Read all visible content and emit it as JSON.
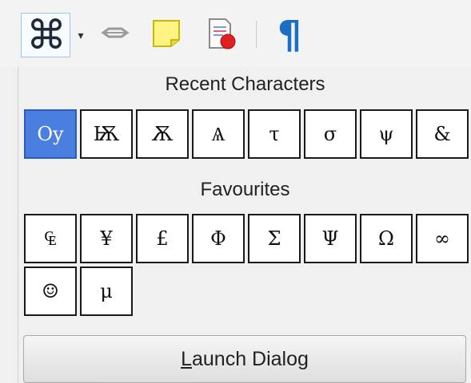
{
  "toolbar": {
    "items": [
      {
        "name": "special-character-button",
        "glyph": "⌘"
      },
      {
        "name": "dropdown-arrow",
        "glyph": "▾"
      },
      {
        "name": "hyperlink-icon"
      },
      {
        "name": "comment-icon"
      },
      {
        "name": "track-changes-icon"
      },
      {
        "name": "formatting-marks-icon",
        "glyph": "¶"
      }
    ]
  },
  "recent": {
    "title": "Recent Characters",
    "chars": [
      "Oy",
      "Ѭ",
      "Ѫ",
      "Ѧ",
      "τ",
      "σ",
      "ψ",
      "&"
    ]
  },
  "favourites": {
    "title": "Favourites",
    "chars": [
      "₠",
      "¥",
      "£",
      "Φ",
      "Σ",
      "Ψ",
      "Ω",
      "∞",
      "☺",
      "μ"
    ]
  },
  "launch": {
    "mnemonic": "L",
    "rest": "aunch Dialog"
  },
  "colors": {
    "selected": "#4a7fe0",
    "accent_blue": "#1a6fc4"
  }
}
